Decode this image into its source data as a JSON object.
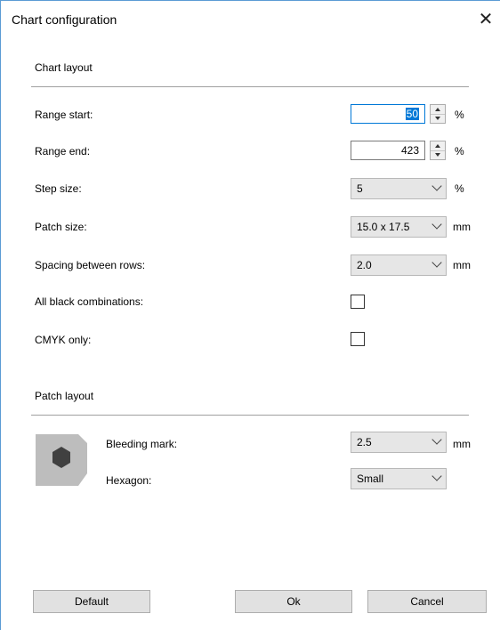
{
  "dialog": {
    "title": "Chart configuration",
    "close_icon": "close-icon"
  },
  "chart_layout": {
    "title": "Chart layout",
    "range_start": {
      "label": "Range start:",
      "value": "50",
      "unit": "%"
    },
    "range_end": {
      "label": "Range end:",
      "value": "423",
      "unit": "%"
    },
    "step_size": {
      "label": "Step size:",
      "value": "5",
      "unit": "%"
    },
    "patch_size": {
      "label": "Patch size:",
      "value": "15.0 x 17.5",
      "unit": "mm"
    },
    "row_spacing": {
      "label": "Spacing between rows:",
      "value": "2.0",
      "unit": "mm"
    },
    "all_black": {
      "label": "All black combinations:",
      "checked": false
    },
    "cmyk_only": {
      "label": "CMYK only:",
      "checked": false
    }
  },
  "patch_layout": {
    "title": "Patch layout",
    "bleeding_mark": {
      "label": "Bleeding mark:",
      "value": "2.5",
      "unit": "mm"
    },
    "hexagon": {
      "label": "Hexagon:",
      "value": "Small"
    }
  },
  "buttons": {
    "default": "Default",
    "ok": "Ok",
    "cancel": "Cancel"
  }
}
